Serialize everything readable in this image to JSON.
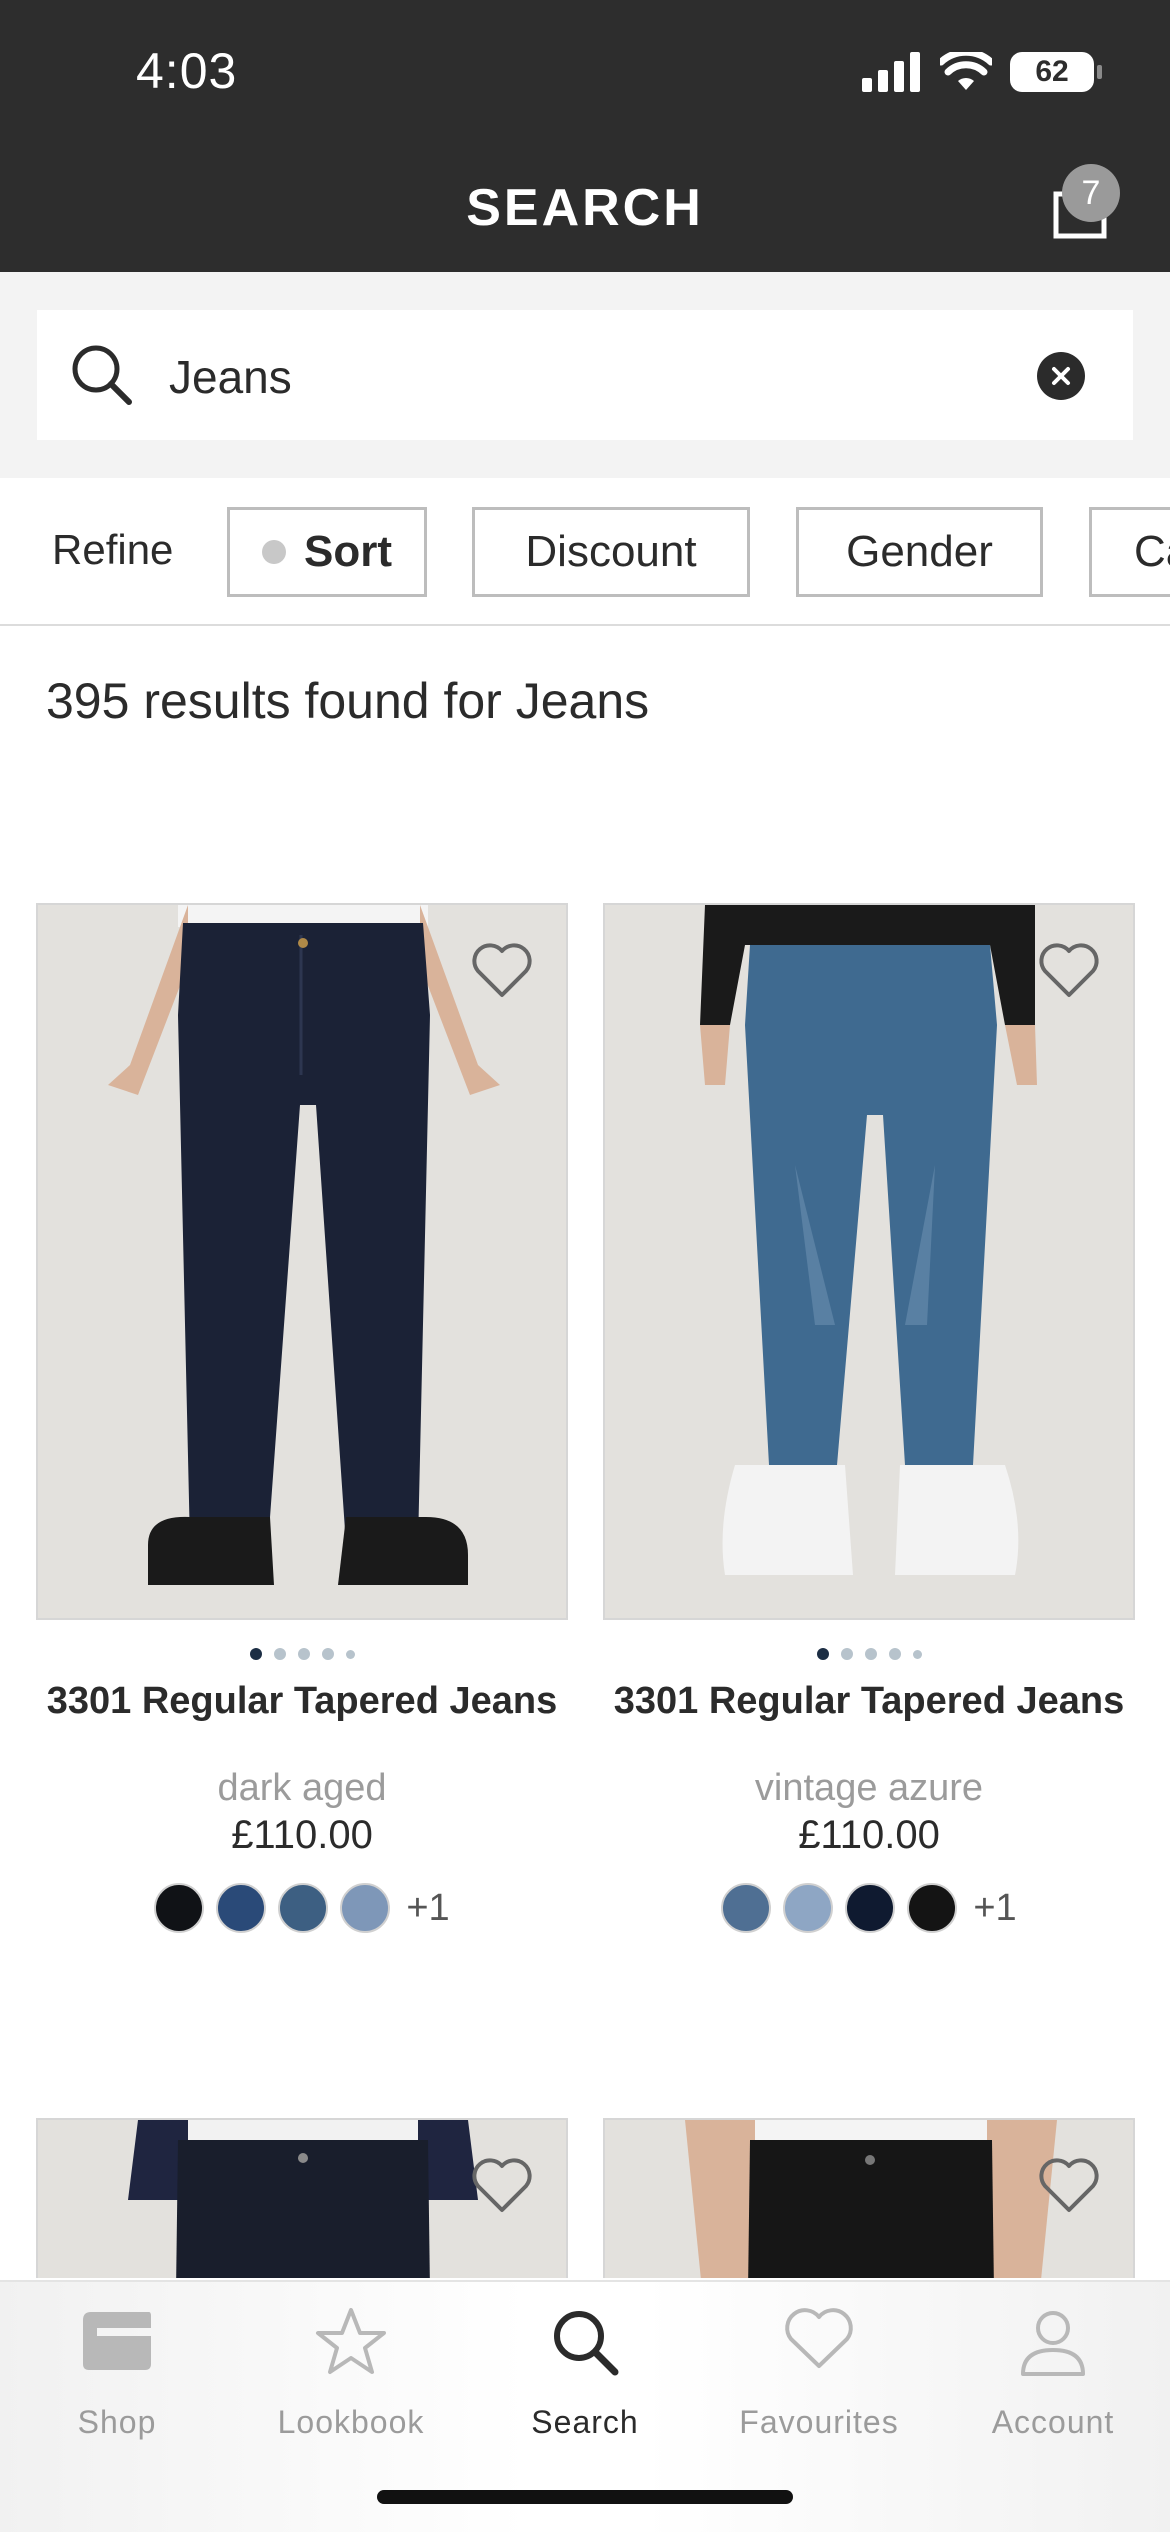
{
  "status": {
    "time": "4:03",
    "battery": "62"
  },
  "header": {
    "title": "SEARCH",
    "cart_count": "7"
  },
  "search": {
    "value": "Jeans",
    "placeholder": ""
  },
  "filters": {
    "refine_label": "Refine",
    "chips": [
      "Sort",
      "Discount",
      "Gender",
      "Ca"
    ]
  },
  "results_text": "395 results found for Jeans",
  "products": [
    {
      "name": "3301 Regular Tapered Jeans",
      "color": "dark aged",
      "price": "£110.00",
      "more_colors": "+1",
      "swatches": [
        "#101216",
        "#2a4a78",
        "#3d5f82",
        "#7e97b8"
      ]
    },
    {
      "name": "3301 Regular Tapered Jeans",
      "color": "vintage azure",
      "price": "£110.00",
      "more_colors": "+1",
      "swatches": [
        "#4f6f93",
        "#8ea6c4",
        "#0f1a30",
        "#141414"
      ]
    }
  ],
  "tabs": [
    {
      "label": "Shop",
      "icon": "shop-icon"
    },
    {
      "label": "Lookbook",
      "icon": "star-icon"
    },
    {
      "label": "Search",
      "icon": "search-icon"
    },
    {
      "label": "Favourites",
      "icon": "heart-icon"
    },
    {
      "label": "Account",
      "icon": "account-icon"
    }
  ],
  "colors": {
    "header_bg": "#2d2d2d",
    "accent_dark": "#1c2e44",
    "muted_text": "#9b9b9b"
  }
}
